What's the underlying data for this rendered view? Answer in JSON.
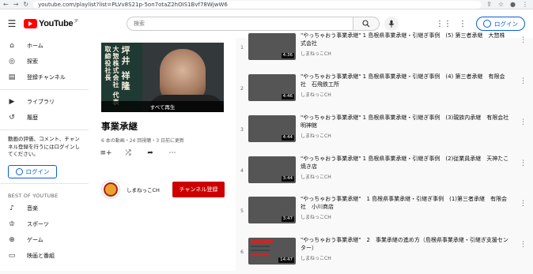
{
  "browser": {
    "url": "youtube.com/playlist?list=PLVv8S21p-5on7otaZ2hOIS1Bvf78WjwW6"
  },
  "header": {
    "brand": "YouTube",
    "region": "JP",
    "search_placeholder": "検索",
    "login_label": "ログイン"
  },
  "sidebar": {
    "items": [
      {
        "label": "ホーム",
        "icon": "home-icon"
      },
      {
        "label": "探索",
        "icon": "compass-icon"
      },
      {
        "label": "登録チャンネル",
        "icon": "subscriptions-icon"
      }
    ],
    "items2": [
      {
        "label": "ライブラリ",
        "icon": "library-icon"
      },
      {
        "label": "履歴",
        "icon": "history-icon"
      }
    ],
    "note": "動画の評価、コメント、チャンネル登録を行うにはログインしてください。",
    "login_label": "ログイン",
    "section_head": "BEST OF YOUTUBE",
    "best": [
      {
        "label": "音楽",
        "icon": "music-icon"
      },
      {
        "label": "スポーツ",
        "icon": "trophy-icon"
      },
      {
        "label": "ゲーム",
        "icon": "gamepad-icon"
      },
      {
        "label": "映画と番組",
        "icon": "film-icon"
      }
    ]
  },
  "playlist": {
    "cover_text_small": "大惣株式会社 代表取締役社長",
    "cover_text_name": "坪井 祥隆",
    "play_all": "すべて再生",
    "title": "事業承継",
    "meta": "6 本の動画・24 回視聴・3 日前に更新",
    "channel_name": "しまねっこCH",
    "subscribe_label": "チャンネル登録"
  },
  "videos": [
    {
      "num": "1",
      "title": "\"やっちゃおう事業承継\" 1 島根県事業承継・引継ぎ事例　(5) 第三者承継　大惣株式会社",
      "channel": "しまねっこCH",
      "duration": "4:36"
    },
    {
      "num": "2",
      "title": "\"やっちゃおう事業承継\" 1 島根県事業承継・引継ぎ事例　(4) 第三者承継　有限会社　石飛鉄工所",
      "channel": "しまねっこCH",
      "duration": "4:46"
    },
    {
      "num": "3",
      "title": "\"やっちゃおう事業承継\" 1 島根県事業承継・引継ぎ事例　(3)親族内承継　有限会社　明神館",
      "channel": "しまねっこCH",
      "duration": "4:44"
    },
    {
      "num": "4",
      "title": "\"やっちゃおう事業承継\" 1 島根県事業承継・引継ぎ事例　(2)従業員承継　天神たこ焼き店",
      "channel": "しまねっこCH",
      "duration": "3:44"
    },
    {
      "num": "5",
      "title": "\"やっちゃおう事業承継\"　1 島根県事業承継・引継ぎ事例　(1)第三者承継　有限会社　小川商店",
      "channel": "しまねっこCH",
      "duration": "3:47"
    },
    {
      "num": "6",
      "title": "\"やっちゃおう事業承継\"　2　事業承継の進め方（島根県事業承継・引継ぎ支援センター）",
      "channel": "しまねっこCH",
      "duration": "14:47"
    }
  ],
  "colors": {
    "brand_red": "#ff0000",
    "subscribe_red": "#cc0000",
    "link_blue": "#065fd4"
  }
}
